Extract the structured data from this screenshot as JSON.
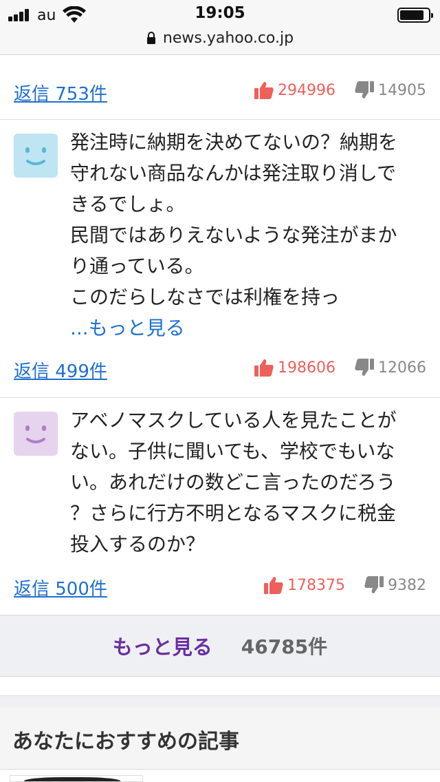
{
  "status_bar": {
    "carrier": "au",
    "time": "19:05",
    "url": "news.yahoo.co.jp",
    "battery_level": 0.85
  },
  "comments": [
    {
      "reply_label": "返信 753件",
      "likes": "294996",
      "dislikes": "14905"
    },
    {
      "avatar_color": "#bfe4f2",
      "avatar_face_color": "#5bb6d6",
      "text_lines": [
        "発注時に納期を決めてないの？納期を",
        "守れない商品なんかは発注取り消しで",
        "きるでしょ。",
        "民間ではありえないような発注がまか",
        "り通っている。",
        "このだらしなさでは利権を持っ"
      ],
      "more_link": "...もっと見る",
      "reply_label": "返信 499件",
      "likes": "198606",
      "dislikes": "12066"
    },
    {
      "avatar_color": "#e6d3ee",
      "avatar_face_color": "#b07cc9",
      "text_lines": [
        "アベノマスクしている人を見たことが",
        "ない。子供に聞いても、学校でもいな",
        "い。あれだけの数どこ言ったのだろう",
        "？さらに行方不明となるマスクに税金",
        "投入するのか？"
      ],
      "reply_label": "返信 500件",
      "likes": "178375",
      "dislikes": "9382"
    }
  ],
  "more_section": {
    "button_label": "もっと見る",
    "count": "46785件"
  },
  "recommend": {
    "title": "あなたにおすすめの記事"
  },
  "colors": {
    "link": "#1e6fd0",
    "like": "#ef5f5b",
    "dislike": "#888888",
    "more_button": "#6a2ea2"
  }
}
